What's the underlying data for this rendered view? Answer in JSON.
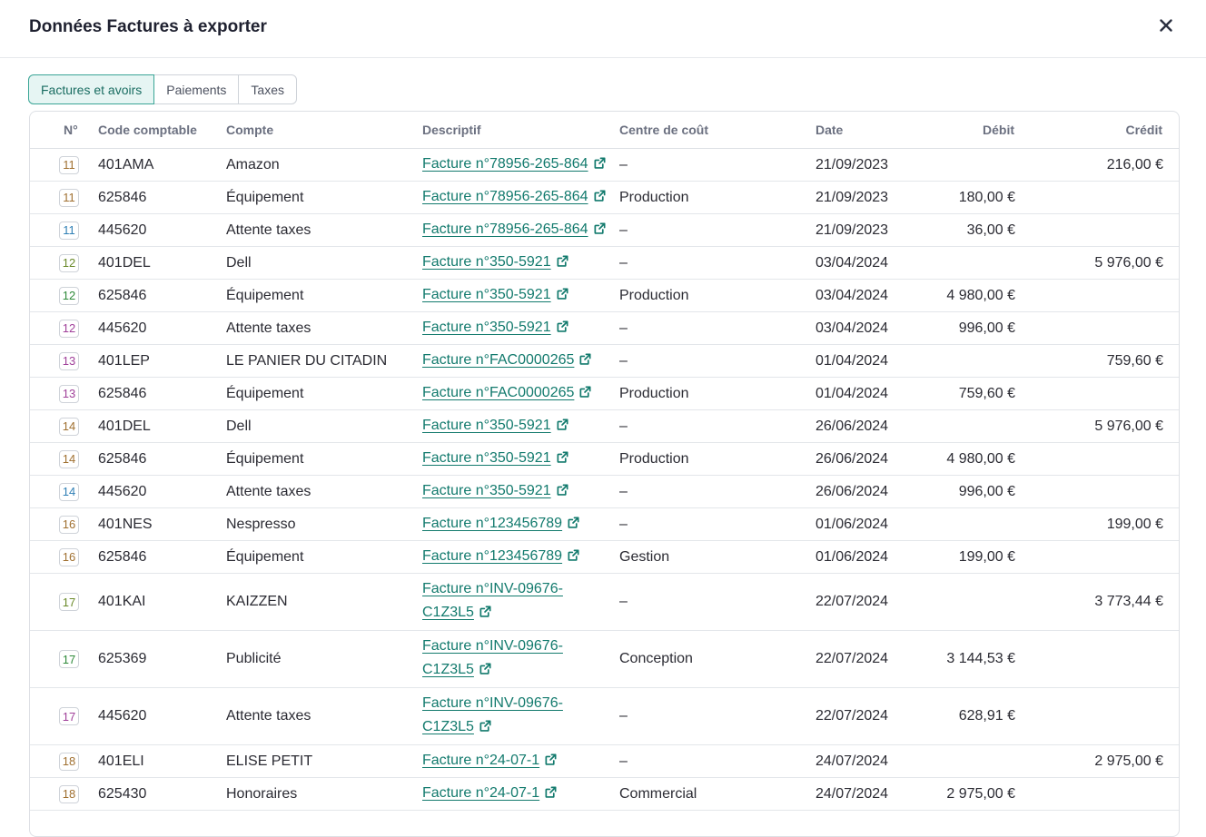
{
  "modal": {
    "title": "Données Factures à exporter"
  },
  "tabs": [
    {
      "label": "Factures et avoirs",
      "active": true
    },
    {
      "label": "Paiements",
      "active": false
    },
    {
      "label": "Taxes",
      "active": false
    }
  ],
  "table": {
    "headers": {
      "num": "N°",
      "code": "Code comptable",
      "compte": "Compte",
      "descriptif": "Descriptif",
      "centre": "Centre de coût",
      "date": "Date",
      "debit": "Débit",
      "credit": "Crédit"
    },
    "rows": [
      {
        "num": "11",
        "num_color": "#a07030",
        "code": "401AMA",
        "compte": "Amazon",
        "desc": "Facture n°78956-265-864",
        "centre": "–",
        "date": "21/09/2023",
        "debit": "",
        "credit": "216,00 €"
      },
      {
        "num": "11",
        "num_color": "#a07030",
        "code": "625846",
        "compte": "Équipement",
        "desc": "Facture n°78956-265-864",
        "centre": "Production",
        "date": "21/09/2023",
        "debit": "180,00 €",
        "credit": ""
      },
      {
        "num": "11",
        "num_color": "#2f7fb5",
        "code": "445620",
        "compte": "Attente taxes",
        "desc": "Facture n°78956-265-864",
        "centre": "–",
        "date": "21/09/2023",
        "debit": "36,00 €",
        "credit": ""
      },
      {
        "num": "12",
        "num_color": "#6a8a2a",
        "code": "401DEL",
        "compte": "Dell",
        "desc": "Facture n°350-5921",
        "centre": "–",
        "date": "03/04/2024",
        "debit": "",
        "credit": "5 976,00 €"
      },
      {
        "num": "12",
        "num_color": "#2f8a3a",
        "code": "625846",
        "compte": "Équipement",
        "desc": "Facture n°350-5921",
        "centre": "Production",
        "date": "03/04/2024",
        "debit": "4 980,00 €",
        "credit": ""
      },
      {
        "num": "12",
        "num_color": "#a0409a",
        "code": "445620",
        "compte": "Attente taxes",
        "desc": "Facture n°350-5921",
        "centre": "–",
        "date": "03/04/2024",
        "debit": "996,00 €",
        "credit": ""
      },
      {
        "num": "13",
        "num_color": "#a0409a",
        "code": "401LEP",
        "compte": "LE PANIER DU CITADIN",
        "desc": "Facture n°FAC0000265",
        "centre": "–",
        "date": "01/04/2024",
        "debit": "",
        "credit": "759,60 €"
      },
      {
        "num": "13",
        "num_color": "#a0409a",
        "code": "625846",
        "compte": "Équipement",
        "desc": "Facture n°FAC0000265",
        "centre": "Production",
        "date": "01/04/2024",
        "debit": "759,60 €",
        "credit": ""
      },
      {
        "num": "14",
        "num_color": "#a07030",
        "code": "401DEL",
        "compte": "Dell",
        "desc": "Facture n°350-5921",
        "centre": "–",
        "date": "26/06/2024",
        "debit": "",
        "credit": "5 976,00 €"
      },
      {
        "num": "14",
        "num_color": "#a07030",
        "code": "625846",
        "compte": "Équipement",
        "desc": "Facture n°350-5921",
        "centre": "Production",
        "date": "26/06/2024",
        "debit": "4 980,00 €",
        "credit": ""
      },
      {
        "num": "14",
        "num_color": "#2f7fb5",
        "code": "445620",
        "compte": "Attente taxes",
        "desc": "Facture n°350-5921",
        "centre": "–",
        "date": "26/06/2024",
        "debit": "996,00 €",
        "credit": ""
      },
      {
        "num": "16",
        "num_color": "#a07030",
        "code": "401NES",
        "compte": "Nespresso",
        "desc": "Facture n°123456789",
        "centre": "–",
        "date": "01/06/2024",
        "debit": "",
        "credit": "199,00 €"
      },
      {
        "num": "16",
        "num_color": "#a07030",
        "code": "625846",
        "compte": "Équipement",
        "desc": "Facture n°123456789",
        "centre": "Gestion",
        "date": "01/06/2024",
        "debit": "199,00 €",
        "credit": ""
      },
      {
        "num": "17",
        "num_color": "#6a8a2a",
        "code": "401KAI",
        "compte": "KAIZZEN",
        "desc": "Facture n°INV-09676-C1Z3L5",
        "centre": "–",
        "date": "22/07/2024",
        "debit": "",
        "credit": "3 773,44 €"
      },
      {
        "num": "17",
        "num_color": "#2f8a3a",
        "code": "625369",
        "compte": "Publicité",
        "desc": "Facture n°INV-09676-C1Z3L5",
        "centre": "Conception",
        "date": "22/07/2024",
        "debit": "3 144,53 €",
        "credit": ""
      },
      {
        "num": "17",
        "num_color": "#a0409a",
        "code": "445620",
        "compte": "Attente taxes",
        "desc": "Facture n°INV-09676-C1Z3L5",
        "centre": "–",
        "date": "22/07/2024",
        "debit": "628,91 €",
        "credit": ""
      },
      {
        "num": "18",
        "num_color": "#a07030",
        "code": "401ELI",
        "compte": "ELISE PETIT",
        "desc": "Facture n°24-07-1",
        "centre": "–",
        "date": "24/07/2024",
        "debit": "",
        "credit": "2 975,00 €"
      },
      {
        "num": "18",
        "num_color": "#a07030",
        "code": "625430",
        "compte": "Honoraires",
        "desc": "Facture n°24-07-1",
        "centre": "Commercial",
        "date": "24/07/2024",
        "debit": "2 975,00 €",
        "credit": ""
      }
    ]
  }
}
